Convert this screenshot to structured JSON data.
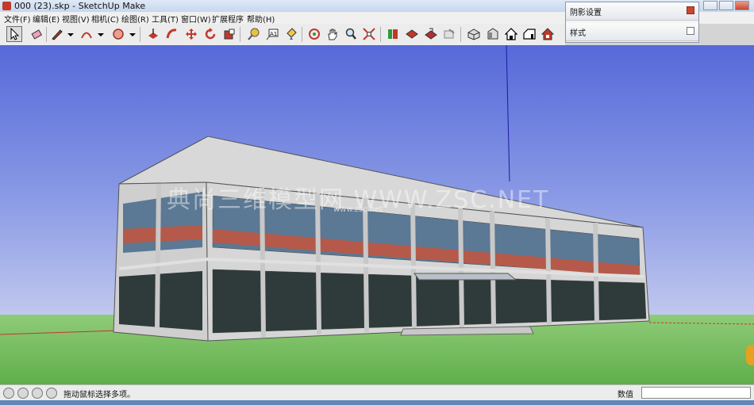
{
  "window": {
    "title": "000 (23).skp - SketchUp Make"
  },
  "menu": [
    {
      "label": "文件(F)"
    },
    {
      "label": "编辑(E)"
    },
    {
      "label": "视图(V)"
    },
    {
      "label": "相机(C)"
    },
    {
      "label": "绘图(R)"
    },
    {
      "label": "工具(T)"
    },
    {
      "label": "窗口(W)"
    },
    {
      "label": "扩展程序"
    },
    {
      "label": "帮助(H)"
    }
  ],
  "toolbar": {
    "tools": [
      {
        "icon": "select-arrow-icon",
        "active": true
      },
      {
        "icon": "eraser-icon"
      },
      {
        "icon": "pencil-line-icon"
      },
      {
        "icon": "dropdown-arrow-icon"
      },
      {
        "icon": "arc-icon"
      },
      {
        "icon": "dropdown-arrow-icon"
      },
      {
        "icon": "shape-circle-icon"
      },
      {
        "icon": "dropdown-arrow-icon"
      },
      {
        "icon": "push-pull-icon"
      },
      {
        "icon": "follow-me-icon"
      },
      {
        "icon": "move-icon"
      },
      {
        "icon": "rotate-icon"
      },
      {
        "icon": "scale-icon"
      },
      {
        "icon": "tape-measure-icon"
      },
      {
        "icon": "text-label-icon"
      },
      {
        "icon": "paint-bucket-icon"
      },
      {
        "icon": "orbit-icon"
      },
      {
        "icon": "pan-hand-icon"
      },
      {
        "icon": "zoom-icon"
      },
      {
        "icon": "zoom-extents-icon"
      },
      {
        "icon": "3d-warehouse-icon"
      },
      {
        "icon": "extension-warehouse-icon"
      },
      {
        "icon": "share-model-icon"
      },
      {
        "icon": "layout-send-icon"
      },
      {
        "icon": "iso-view-icon"
      },
      {
        "icon": "top-view-icon"
      },
      {
        "icon": "front-view-icon"
      },
      {
        "icon": "right-view-icon"
      },
      {
        "icon": "back-view-icon"
      },
      {
        "icon": "left-view-icon"
      }
    ]
  },
  "tray": {
    "panels": [
      {
        "label": "阴影设置"
      },
      {
        "label": "样式"
      }
    ]
  },
  "viewport": {
    "watermark": "典尚三维模型网 WWW.ZSC.NET",
    "watermark_sub": "www.zsc.net"
  },
  "status": {
    "hint": "拖动鼠标选择多项。",
    "vcb_label": "数值",
    "vcb_value": ""
  },
  "colors": {
    "sky_top": "#5569d9",
    "sky_bottom": "#d8dcf0",
    "ground": "#6fb85a",
    "axis_blue": "#1a1aa0",
    "axis_red": "#c0392b"
  }
}
